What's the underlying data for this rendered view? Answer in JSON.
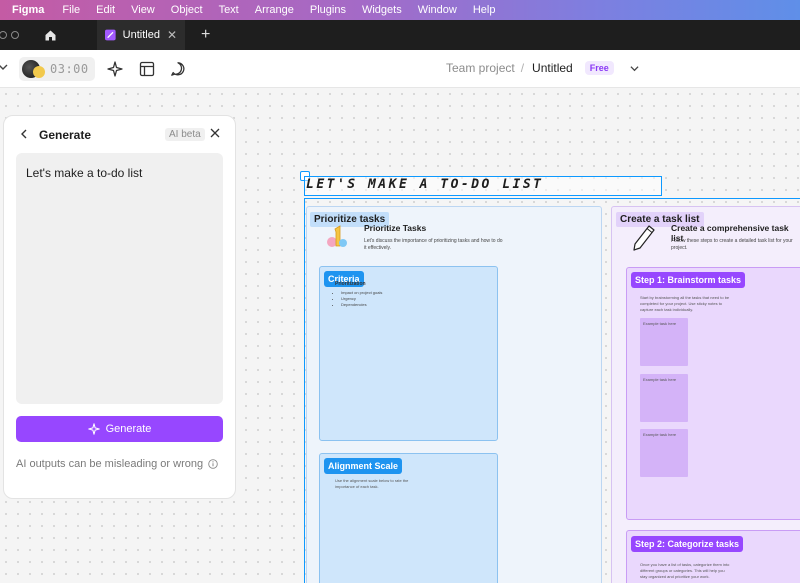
{
  "menubar": {
    "app": "Figma",
    "items": [
      "File",
      "Edit",
      "View",
      "Object",
      "Text",
      "Arrange",
      "Plugins",
      "Widgets",
      "Window",
      "Help"
    ]
  },
  "tabs": {
    "active_tab": "Untitled",
    "home_icon": "home-icon",
    "close_icon": "close-icon",
    "new_tab": "+"
  },
  "toolbar": {
    "timer": "03:00",
    "icons": [
      "sparkle-icon",
      "layout-icon",
      "comment-icon"
    ],
    "breadcrumb": {
      "team": "Team project",
      "separator": "/",
      "file": "Untitled",
      "plan_badge": "Free"
    }
  },
  "generate_panel": {
    "title": "Generate",
    "badge": "AI beta",
    "prompt": "Let's make a to-do list",
    "button": "Generate",
    "disclaimer": "AI outputs can be misleading or wrong"
  },
  "board": {
    "title": "LET'S MAKE A TO-DO LIST",
    "section1": {
      "label": "Prioritize tasks",
      "heading": "Prioritize Tasks",
      "body": "Let's discuss the importance of prioritizing tasks and how to do it effectively.",
      "cards": [
        {
          "tag": "Criteria",
          "subtitle": "Prioritization",
          "items": [
            "Impact on project goals",
            "Urgency",
            "Dependencies"
          ]
        },
        {
          "tag": "Alignment Scale",
          "text": "Use the alignment scale below to rate the importance of each task."
        }
      ]
    },
    "section2": {
      "label": "Create a task list",
      "heading": "Create a comprehensive task list",
      "body": "Follow these steps to create a detailed task list for your project.",
      "cards": [
        {
          "tag": "Step 1: Brainstorm tasks",
          "text": "Start by brainstorming all the tasks that need to be completed for your project. Use sticky notes to capture each task individually.",
          "stickies": [
            "Example task here",
            "Example task here",
            "Example task here"
          ]
        },
        {
          "tag": "Step 2: Categorize tasks",
          "text": "Once you have a list of tasks, categorize them into different groups or categories. This will help you stay organized and prioritize your work."
        }
      ]
    }
  },
  "colors": {
    "accent": "#9747ff",
    "selection": "#0d99ff",
    "tab_bar": "#1e1e1e",
    "menubar_start": "#c45ba4",
    "menubar_end": "#5f8fe8"
  }
}
